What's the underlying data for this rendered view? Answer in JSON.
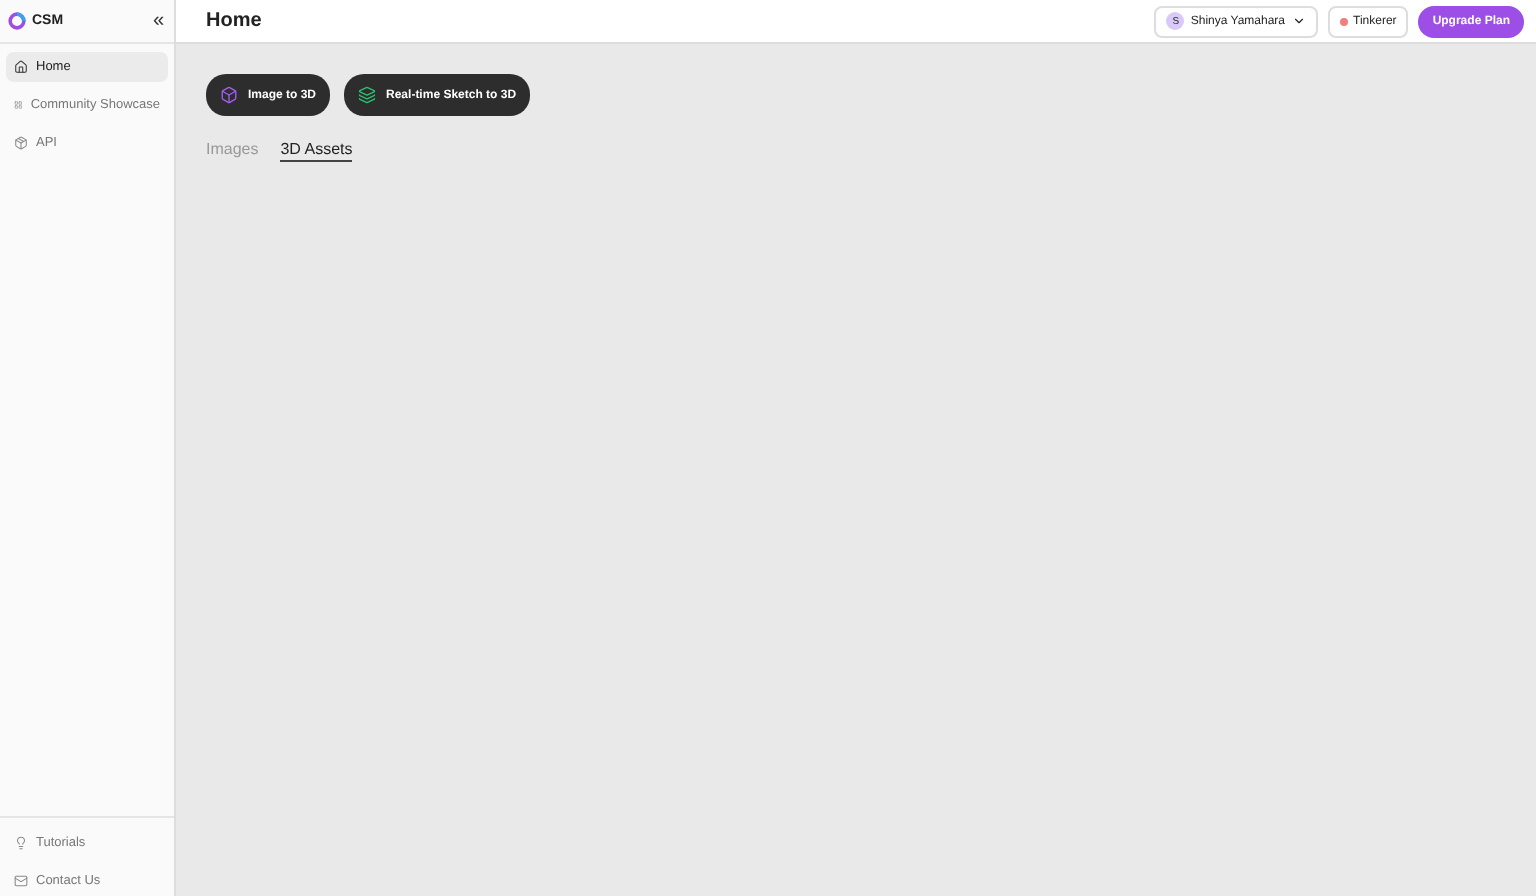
{
  "sidebar": {
    "logo": "CSM",
    "collapse": "«",
    "items": [
      {
        "label": "Home",
        "selected": true
      },
      {
        "label": "Community Showcase",
        "selected": false
      },
      {
        "label": "API",
        "selected": false
      }
    ],
    "footer": [
      {
        "label": "Tutorials"
      },
      {
        "label": "Contact Us"
      }
    ]
  },
  "header": {
    "title": "Home",
    "user": {
      "initial": "S",
      "name": "Shinya Yamahara"
    },
    "plan": "Tinkerer",
    "upgrade": "Upgrade Plan"
  },
  "actions": [
    {
      "label": "Image to 3D"
    },
    {
      "label": "Real-time Sketch to 3D"
    }
  ],
  "tabs": [
    {
      "label": "Images",
      "selected": false
    },
    {
      "label": "3D Assets",
      "selected": true
    }
  ]
}
